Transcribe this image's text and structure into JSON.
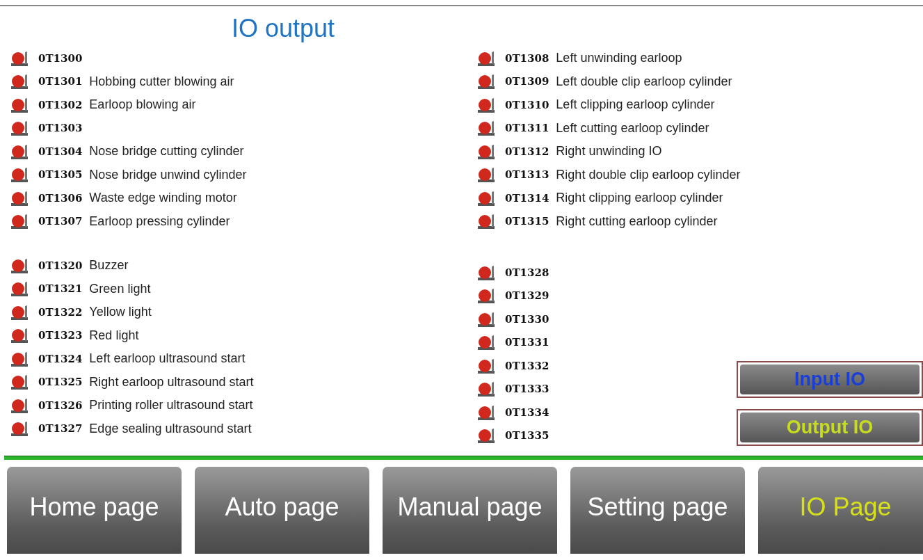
{
  "title": "IO output",
  "left_column": [
    {
      "items": [
        {
          "code": "0T1300",
          "on": false
        },
        {
          "code": "0T1301",
          "label": "Hobbing cutter blowing air",
          "on": false
        },
        {
          "code": "0T1302",
          "label": "Earloop blowing air",
          "on": false
        },
        {
          "code": "0T1303",
          "on": false
        },
        {
          "code": "0T1304",
          "label": "Nose bridge cutting cylinder",
          "on": false
        },
        {
          "code": "0T1305",
          "label": "Nose bridge unwind cylinder",
          "on": false
        },
        {
          "code": "0T1306",
          "label": "Waste edge winding motor",
          "on": false
        },
        {
          "code": "0T1307",
          "label": "Earloop pressing cylinder",
          "on": false
        }
      ]
    },
    {
      "items": [
        {
          "code": "0T1320",
          "label": "Buzzer",
          "on": false
        },
        {
          "code": "0T1321",
          "label": "Green light",
          "on": false
        },
        {
          "code": "0T1322",
          "label": "Yellow light",
          "on": false
        },
        {
          "code": "0T1323",
          "label": "Red light",
          "on": false
        },
        {
          "code": "0T1324",
          "label": "Left earloop ultrasound start",
          "on": false
        },
        {
          "code": "0T1325",
          "label": "Right earloop ultrasound start",
          "on": false
        },
        {
          "code": "0T1326",
          "label": "Printing roller ultrasound start",
          "on": false
        },
        {
          "code": "0T1327",
          "label": "Edge sealing ultrasound start",
          "on": false
        }
      ]
    }
  ],
  "right_column": [
    {
      "items": [
        {
          "code": "0T1308",
          "label": "Left unwinding earloop",
          "on": false
        },
        {
          "code": "0T1309",
          "label": "Left double clip earloop cylinder",
          "on": false
        },
        {
          "code": "0T1310",
          "label": "Left clipping earloop cylinder",
          "on": false
        },
        {
          "code": "0T1311",
          "label": "Left cutting earloop cylinder",
          "on": false
        },
        {
          "code": "0T1312",
          "label": "Right unwinding IO",
          "on": false
        },
        {
          "code": "0T1313",
          "label": "Right double clip earloop cylinder",
          "on": false
        },
        {
          "code": "0T1314",
          "label": "Right clipping earloop cylinder",
          "on": false
        },
        {
          "code": "0T1315",
          "label": "Right cutting earloop cylinder",
          "on": false
        }
      ]
    },
    {
      "items": [
        {
          "code": "0T1328",
          "on": false
        },
        {
          "code": "0T1329",
          "on": false
        },
        {
          "code": "0T1330",
          "on": false
        },
        {
          "code": "0T1331",
          "on": false
        },
        {
          "code": "0T1332",
          "on": false
        },
        {
          "code": "0T1333",
          "on": false
        },
        {
          "code": "0T1334",
          "on": false
        },
        {
          "code": "0T1335",
          "on": false
        }
      ]
    }
  ],
  "io_buttons": [
    {
      "label": "Input IO",
      "selected": false
    },
    {
      "label": "Output IO",
      "selected": true
    }
  ],
  "nav_tabs": [
    {
      "label": "Home page",
      "selected": false
    },
    {
      "label": "Auto page",
      "selected": false
    },
    {
      "label": "Manual page",
      "selected": false
    },
    {
      "label": "Setting page",
      "selected": false
    },
    {
      "label": "IO Page",
      "selected": true
    }
  ]
}
